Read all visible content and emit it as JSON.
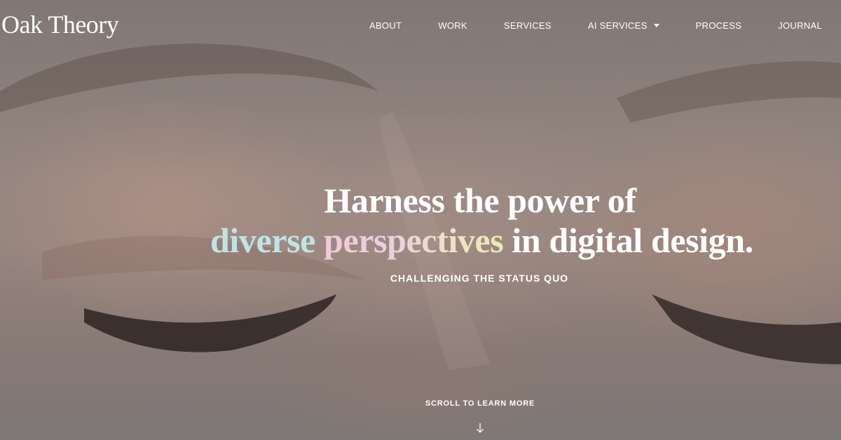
{
  "brand": {
    "name": "Oak Theory"
  },
  "nav": {
    "items": [
      {
        "label": "ABOUT"
      },
      {
        "label": "WORK"
      },
      {
        "label": "SERVICES"
      },
      {
        "label": "AI SERVICES",
        "has_dropdown": true
      },
      {
        "label": "PROCESS"
      },
      {
        "label": "JOURNAL"
      }
    ]
  },
  "hero": {
    "headline_line1": "Harness the power of",
    "headline_word_a": "diverse",
    "headline_word_b": "perspectives",
    "headline_rest": "in digital design.",
    "tagline": "CHALLENGING THE STATUS QUO",
    "scroll_label": "SCROLL TO LEARN MORE",
    "scroll_icon": "arrow-down-icon",
    "background_image": "closed-eyes-photo"
  },
  "colors": {
    "text": "#ffffff",
    "accent_teal": "#bfe4e6",
    "accent_pink": "#f1c9d6",
    "accent_yellow": "#e8eab8"
  }
}
